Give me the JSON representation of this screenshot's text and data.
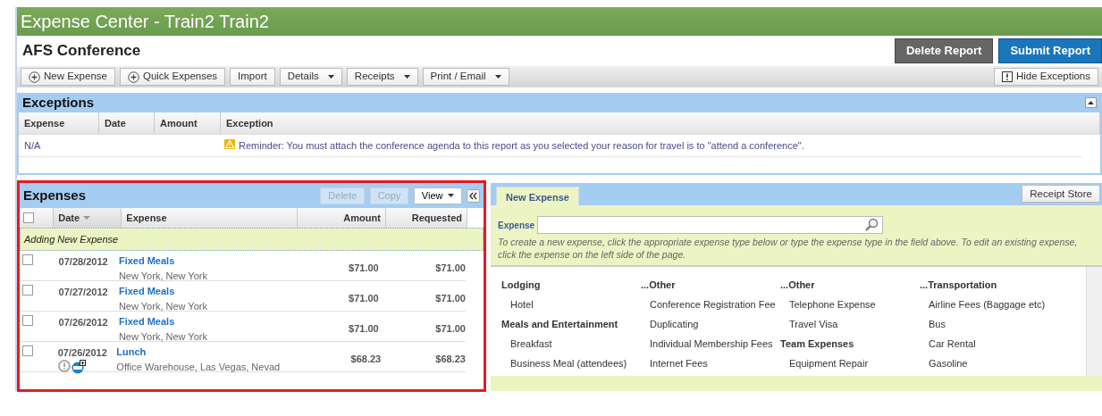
{
  "app_title": "Expense Center - Train2 Train2",
  "report": {
    "title": "AFS Conference",
    "actions": [
      {
        "label": "Delete Report",
        "kind": "secondary"
      },
      {
        "label": "Submit Report",
        "kind": "primary"
      }
    ]
  },
  "toolbar": {
    "buttons": [
      {
        "label": "New Expense",
        "kind": "add"
      },
      {
        "label": "Quick Expenses",
        "kind": "add"
      },
      {
        "label": "Import",
        "kind": "plain"
      },
      {
        "label": "Details",
        "kind": "menu"
      },
      {
        "label": "Receipts",
        "kind": "menu"
      },
      {
        "label": "Print / Email",
        "kind": "menu"
      }
    ],
    "right_button": "Hide Exceptions"
  },
  "exceptions": {
    "title": "Exceptions",
    "columns": [
      "Expense",
      "Date",
      "Amount",
      "Exception"
    ],
    "rows": [
      {
        "expense": "N/A",
        "exception": "Reminder: You must attach the conference agenda to this report as you selected your reason for travel is to \"attend a conference\"."
      }
    ]
  },
  "expenses": {
    "title": "Expenses",
    "actions": [
      {
        "label": "Delete",
        "disabled": true
      },
      {
        "label": "Copy",
        "disabled": true
      }
    ],
    "view_button": "View",
    "select_all_checked": false,
    "columns": [
      {
        "label": "Date",
        "sorted": true
      },
      {
        "label": "Expense",
        "sorted": false
      },
      {
        "label": "Amount",
        "sorted": false
      },
      {
        "label": "Requested",
        "sorted": false
      }
    ],
    "adding_row": "Adding New Expense",
    "rows": [
      {
        "checked": false,
        "date": "07/28/2012",
        "type": "Fixed Meals",
        "location": "New York, New York",
        "amount": "$71.00",
        "requested": "$71.00",
        "has_exception": false,
        "has_receipt": false
      },
      {
        "checked": false,
        "date": "07/27/2012",
        "type": "Fixed Meals",
        "location": "New York, New York",
        "amount": "$71.00",
        "requested": "$71.00",
        "has_exception": false,
        "has_receipt": false
      },
      {
        "checked": false,
        "date": "07/26/2012",
        "type": "Fixed Meals",
        "location": "New York, New York",
        "amount": "$71.00",
        "requested": "$71.00",
        "has_exception": false,
        "has_receipt": false
      },
      {
        "checked": false,
        "date": "07/26/2012",
        "type": "Lunch",
        "location": "Office Warehouse, Las Vegas, Nevad",
        "amount": "$68.23",
        "requested": "$68.23",
        "has_exception": true,
        "has_receipt": true
      }
    ]
  },
  "new_expense": {
    "tab": "New Expense",
    "receipt_button": "Receipt Store",
    "field_label": "Expense",
    "hint": "To create a new expense, click the appropriate expense type below or type the expense type in the field above. To edit an existing expense, click the expense on the left side of the page.",
    "type_columns": [
      [
        {
          "kind": "heading",
          "label": "Lodging"
        },
        {
          "kind": "item",
          "label": "Hotel"
        },
        {
          "kind": "heading",
          "label": "Meals and Entertainment"
        },
        {
          "kind": "item",
          "label": "Breakfast"
        },
        {
          "kind": "item",
          "label": "Business Meal (attendees)"
        }
      ],
      [
        {
          "kind": "heading",
          "label": "...Other"
        },
        {
          "kind": "item",
          "label": "Conference Registration Fee"
        },
        {
          "kind": "item",
          "label": "Duplicating"
        },
        {
          "kind": "item",
          "label": "Individual Membership Fees"
        },
        {
          "kind": "item",
          "label": "Internet Fees"
        }
      ],
      [
        {
          "kind": "heading",
          "label": "...Other"
        },
        {
          "kind": "item",
          "label": "Telephone Expense"
        },
        {
          "kind": "item",
          "label": "Travel Visa"
        },
        {
          "kind": "heading",
          "label": "Team Expenses"
        },
        {
          "kind": "item",
          "label": "Equipment Repair"
        }
      ],
      [
        {
          "kind": "heading",
          "label": "...Transportation"
        },
        {
          "kind": "item",
          "label": "Airline Fees (Baggage etc)"
        },
        {
          "kind": "item",
          "label": "Bus"
        },
        {
          "kind": "item",
          "label": "Car Rental"
        },
        {
          "kind": "item",
          "label": "Gasoline"
        }
      ]
    ]
  }
}
